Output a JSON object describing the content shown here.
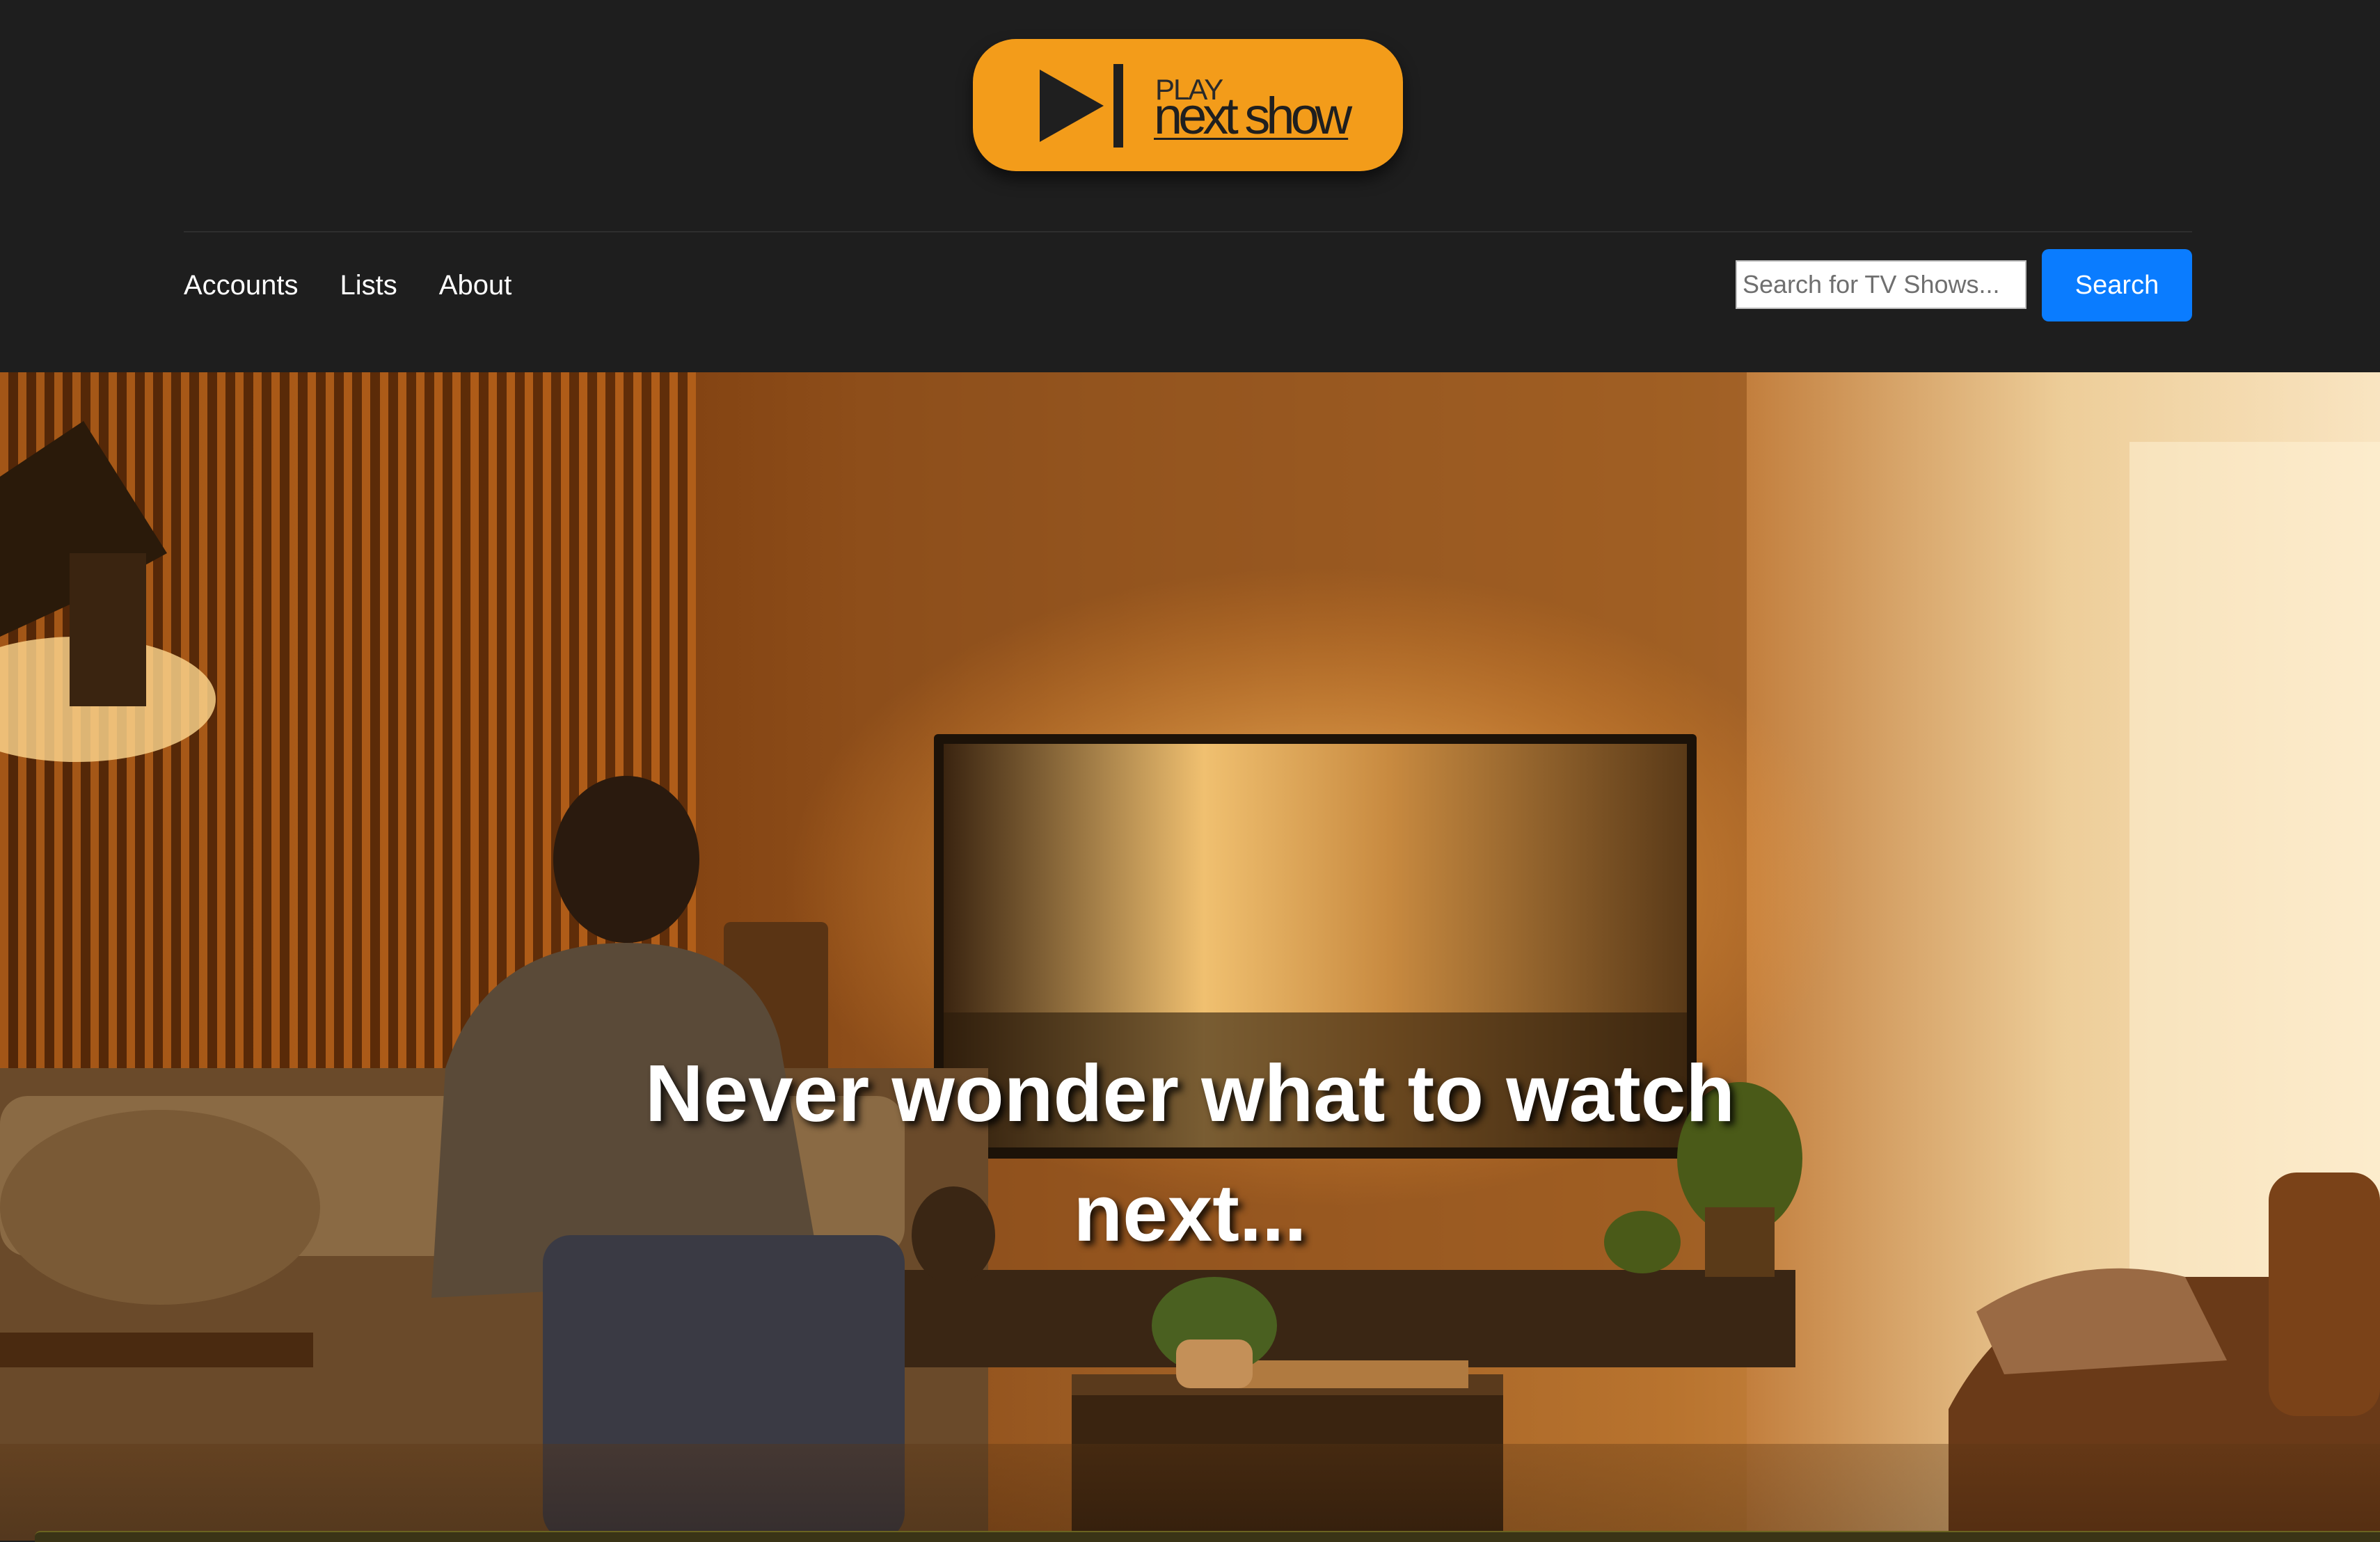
{
  "brand": {
    "play_word": "PLAY",
    "name": "next show",
    "accent_color": "#f39c1a",
    "icon": "play-next-icon"
  },
  "nav": {
    "items": [
      {
        "label": "Accounts"
      },
      {
        "label": "Lists"
      },
      {
        "label": "About"
      }
    ]
  },
  "search": {
    "placeholder": "Search for TV Shows...",
    "value": "",
    "button_label": "Search",
    "button_color": "#0a7cff"
  },
  "hero": {
    "headline": "Never wonder what to watch next...",
    "image": "living-room-tv-scene"
  }
}
